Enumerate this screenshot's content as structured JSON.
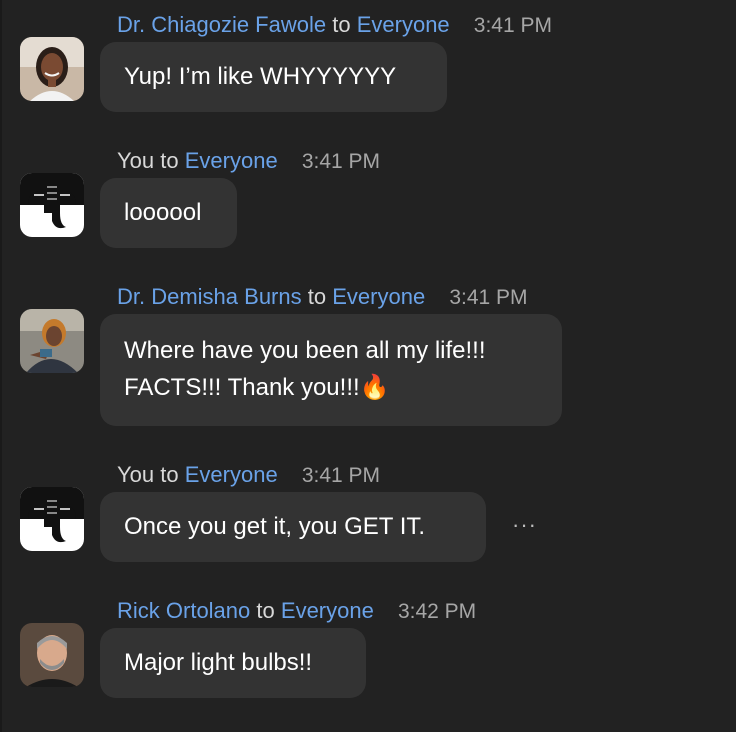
{
  "messages": [
    {
      "sender": "Dr. Chiagozie Fawole",
      "to_word": "to",
      "target": "Everyone",
      "time": "3:41 PM",
      "lines": [
        "Yup! I’m like WHYYYYYY"
      ]
    },
    {
      "sender": "You",
      "to_word": "to",
      "target": "Everyone",
      "time": "3:41 PM",
      "lines": [
        "loooool"
      ]
    },
    {
      "sender": "Dr. Demisha Burns",
      "to_word": "to",
      "target": "Everyone",
      "time": "3:41 PM",
      "lines": [
        "Where have you been all my life!!!",
        "FACTS!!! Thank you!!!🔥"
      ]
    },
    {
      "sender": "You",
      "to_word": "to",
      "target": "Everyone",
      "time": "3:41 PM",
      "lines": [
        "Once you get it, you GET IT."
      ],
      "more_menu": "···"
    },
    {
      "sender": "Rick Ortolano",
      "to_word": "to",
      "target": "Everyone",
      "time": "3:42 PM",
      "lines": [
        "Major light bulbs!!"
      ]
    }
  ],
  "colors": {
    "background": "#222222",
    "bubble": "#333333",
    "link": "#6aa2e8",
    "timestamp": "#a6a6a6"
  },
  "icons": {
    "self_avatar": "elephant-logo-icon",
    "more_menu": "ellipsis-icon"
  }
}
